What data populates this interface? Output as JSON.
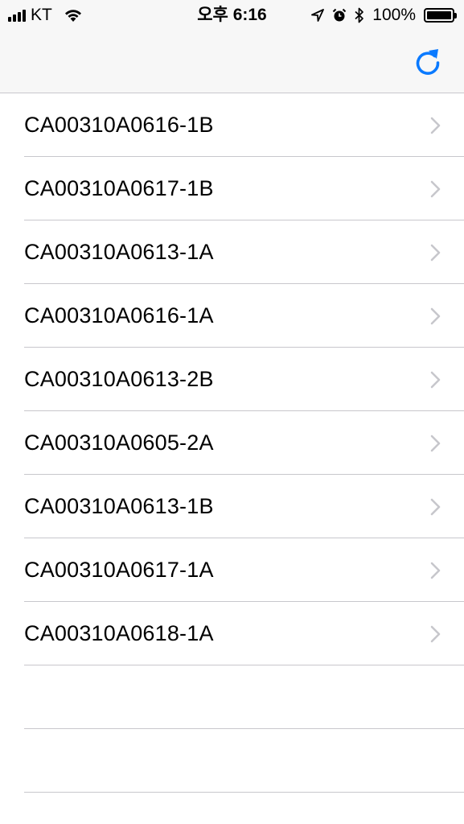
{
  "status_bar": {
    "carrier": "KT",
    "time": "오후 6:16",
    "battery_percent": "100%",
    "icons": [
      "signal-icon",
      "wifi-icon",
      "location-icon",
      "alarm-icon",
      "bluetooth-icon",
      "battery-icon"
    ]
  },
  "nav_bar": {
    "right_button_icon": "refresh-icon",
    "accent_color": "#0a7aff"
  },
  "list": {
    "items": [
      {
        "label": "CA00310A0616-1B"
      },
      {
        "label": "CA00310A0617-1B"
      },
      {
        "label": "CA00310A0613-1A"
      },
      {
        "label": "CA00310A0616-1A"
      },
      {
        "label": "CA00310A0613-2B"
      },
      {
        "label": "CA00310A0605-2A"
      },
      {
        "label": "CA00310A0613-1B"
      },
      {
        "label": "CA00310A0617-1A"
      },
      {
        "label": "CA00310A0618-1A"
      }
    ]
  }
}
